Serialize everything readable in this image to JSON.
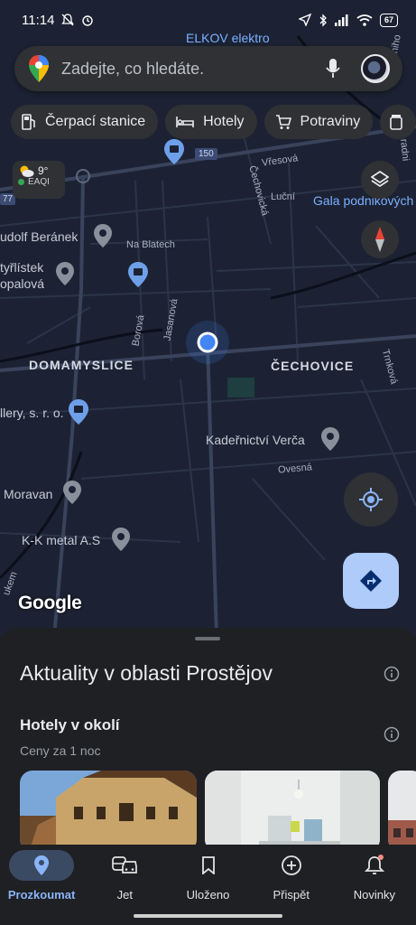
{
  "status_bar": {
    "time": "11:14",
    "battery": "67",
    "icons": [
      "mute-bell-icon",
      "alarm-icon",
      "location-arrow-icon",
      "bluetooth-icon",
      "signal-icon",
      "wifi-icon",
      "battery-icon"
    ]
  },
  "search": {
    "placeholder": "Zadejte, co hledáte.",
    "icons": [
      "maps-pin-logo-icon",
      "microphone-icon",
      "avatar"
    ]
  },
  "chips": [
    {
      "label": "Čerpací stanice",
      "icon": "gas-station-icon"
    },
    {
      "label": "Hotely",
      "icon": "bed-icon"
    },
    {
      "label": "Potraviny",
      "icon": "cart-icon"
    }
  ],
  "weather": {
    "temp": "9°",
    "aqi": "EAQI",
    "aqi_color": "#34a853"
  },
  "map": {
    "labels": {
      "elkov": "ELKOV elektro",
      "vresova": "Vřesová",
      "lucni": "Luční",
      "cechovicka": "Čechovická",
      "gala": "Gala podnikových",
      "beranek": "udolf Beránek",
      "na_blatech": "Na Blatech",
      "ctyrlistek": "tyřlístek",
      "topalova": "opalová",
      "borova": "Borová",
      "jasanova": "Jasanová",
      "domamyslice": "DOMAMYSLICE",
      "cechovice": "ČECHOVICE",
      "trnkova": "Trnková",
      "gallery": "llery, s. r. o.",
      "kadernictvi": "Kadeřnictví Verča",
      "ovesna": "Ovesná",
      "moravan": "Moravan",
      "kk_metal": "K-K metal A.S",
      "road_150": "150",
      "road_77": "77",
      "dukem": "ukem",
      "ledniho": "ledniho",
      "radni": "radni"
    },
    "google": "Google",
    "accent_location": "#4285f4"
  },
  "sheet": {
    "title": "Aktuality v oblasti Prostějov",
    "section_title": "Hotely v okolí",
    "section_sub": "Ceny za 1 noc"
  },
  "nav": [
    {
      "label": "Prozkoumat",
      "icon": "location-pin-icon",
      "active": true
    },
    {
      "label": "Jet",
      "icon": "commute-icon",
      "active": false
    },
    {
      "label": "Uloženo",
      "icon": "bookmark-icon",
      "active": false
    },
    {
      "label": "Přispět",
      "icon": "add-circle-icon",
      "active": false
    },
    {
      "label": "Novinky",
      "icon": "bell-icon",
      "active": false
    }
  ]
}
